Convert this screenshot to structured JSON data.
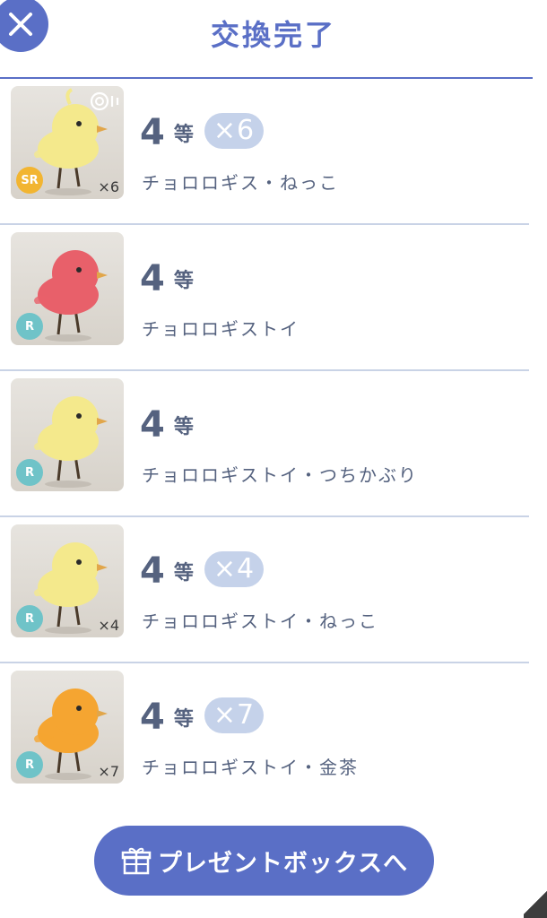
{
  "header": {
    "title": "交換完了",
    "close_icon": "close-icon"
  },
  "items": [
    {
      "rank_number": "4",
      "rank_suffix": "等",
      "count_badge": "×6",
      "name": "チョロロギス・ねっこ",
      "rarity": "SR",
      "rarity_color": "#f2b531",
      "thumb_count": "×6",
      "bird_color": "#f4e98c",
      "has_sound_icon": true
    },
    {
      "rank_number": "4",
      "rank_suffix": "等",
      "count_badge": "",
      "name": "チョロロギストイ",
      "rarity": "R",
      "rarity_color": "#6fc3c8",
      "thumb_count": "",
      "bird_color": "#e8606a",
      "has_sound_icon": false
    },
    {
      "rank_number": "4",
      "rank_suffix": "等",
      "count_badge": "",
      "name": "チョロロギストイ・つちかぶり",
      "rarity": "R",
      "rarity_color": "#6fc3c8",
      "thumb_count": "",
      "bird_color": "#f4e98c",
      "has_sound_icon": false
    },
    {
      "rank_number": "4",
      "rank_suffix": "等",
      "count_badge": "×4",
      "name": "チョロロギストイ・ねっこ",
      "rarity": "R",
      "rarity_color": "#6fc3c8",
      "thumb_count": "×4",
      "bird_color": "#f4e98c",
      "has_sound_icon": false
    },
    {
      "rank_number": "4",
      "rank_suffix": "等",
      "count_badge": "×7",
      "name": "チョロロギストイ・金茶",
      "rarity": "R",
      "rarity_color": "#6fc3c8",
      "thumb_count": "×7",
      "bird_color": "#f5a531",
      "has_sound_icon": false
    }
  ],
  "footer": {
    "present_button_label": "プレゼントボックスへ",
    "present_icon": "gift-icon"
  },
  "colors": {
    "accent": "#5a6fc6",
    "text": "#55627f",
    "badge": "#c5d2ea",
    "divider": "#c9d3e6"
  }
}
